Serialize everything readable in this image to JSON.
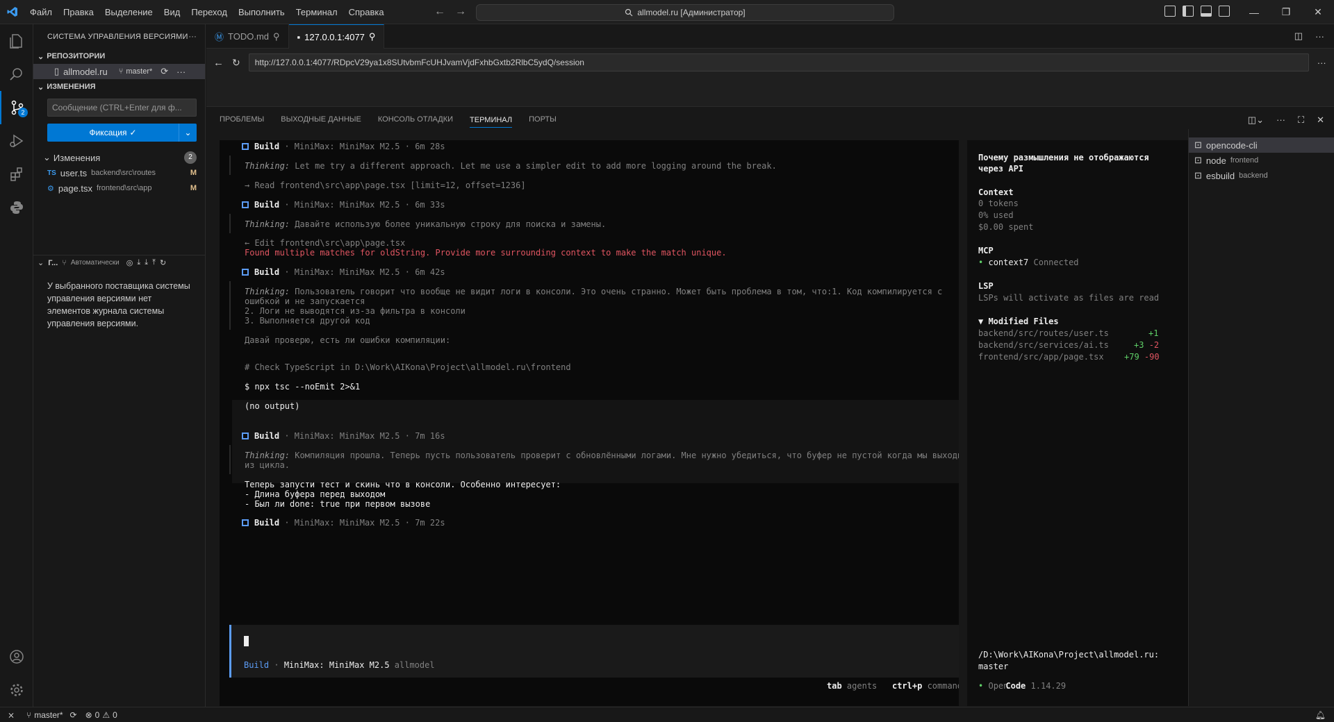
{
  "titlebar": {
    "menu": [
      "Файл",
      "Правка",
      "Выделение",
      "Вид",
      "Переход",
      "Выполнить",
      "Терминал",
      "Справка"
    ],
    "command_center": "allmodel.ru [Администратор]"
  },
  "sidebar": {
    "title": "СИСТЕМА УПРАВЛЕНИЯ ВЕРСИЯМИ",
    "repos_header": "РЕПОЗИТОРИИ",
    "repo_name": "allmodel.ru",
    "repo_branch": "master*",
    "changes_header": "ИЗМЕНЕНИЯ",
    "message_placeholder": "Сообщение (CTRL+Enter для ф...",
    "commit_label": "Фиксация",
    "changes_group": "Изменения",
    "changes_count": "2",
    "files": [
      {
        "icon": "TS",
        "name": "user.ts",
        "path": "backend\\src\\routes",
        "status": "M"
      },
      {
        "icon": "⚙",
        "name": "page.tsx",
        "path": "frontend\\src\\app",
        "status": "M"
      }
    ],
    "graph_title": "Г...",
    "graph_mode": "Автоматически",
    "graph_message": "У выбранного поставщика системы управления версиями нет элементов журнала системы управления версиями."
  },
  "tabs": [
    {
      "label": "TODO.md",
      "active": false
    },
    {
      "label": "127.0.0.1:4077",
      "active": true
    }
  ],
  "browser": {
    "url": "http://127.0.0.1:4077/RDpcV29ya1x8SUtvbmFcUHJvamVjdFxhbGxtb2RlbC5ydQ/session"
  },
  "panel": {
    "tabs": [
      "ПРОБЛЕМЫ",
      "ВЫХОДНЫЕ ДАННЫЕ",
      "КОНСОЛЬ ОТЛАДКИ",
      "ТЕРМИНАЛ",
      "ПОРТЫ"
    ],
    "active_tab": "ТЕРМИНАЛ"
  },
  "terminal": {
    "build1": {
      "label": "Build",
      "meta": "· MiniMax: MiniMax M2.5 · 6m 28s"
    },
    "thinking1_label": "Thinking:",
    "thinking1_text": "Let me try a different approach. Let me use a simpler edit to add more logging around the break.",
    "read_line": "→ Read frontend\\src\\app\\page.tsx [limit=12, offset=1236]",
    "build2": {
      "label": "Build",
      "meta": "· MiniMax: MiniMax M2.5 · 6m 33s"
    },
    "thinking2_label": "Thinking:",
    "thinking2_text": "Давайте использую более уникальную строку для поиска и замены.",
    "edit_line": "← Edit frontend\\src\\app\\page.tsx",
    "edit_error": "Found multiple matches for oldString. Provide more surrounding context to make the match unique.",
    "build3": {
      "label": "Build",
      "meta": "· MiniMax: MiniMax M2.5 · 6m 42s"
    },
    "thinking3_label": "Thinking:",
    "thinking3_line1": "Пользователь говорит что вообще не видит логи в консоли. Это очень странно. Может быть проблема в том, что:1. Код компилируется с",
    "thinking3_line2": "ошибкой и не запускается",
    "thinking3_line3": "2. Логи не выводятся из-за фильтра в консоли",
    "thinking3_line4": "3. Выполняется другой код",
    "check_text": "Давай проверю, есть ли ошибки компиляции:",
    "code_comment": "# Check TypeScript in D:\\Work\\AIKona\\Project\\allmodel.ru\\frontend",
    "code_cmd": "$ npx tsc --noEmit 2>&1",
    "code_output": "(no output)",
    "build4": {
      "label": "Build",
      "meta": "· MiniMax: MiniMax M2.5 · 7m 16s"
    },
    "thinking4_label": "Thinking:",
    "thinking4_line1": "Компиляция прошла. Теперь пусть пользователь проверит с обновлёнными логами. Мне нужно убедиться, что буфер не пустой когда мы выходим",
    "thinking4_line2": "из цикла.",
    "answer_line1": "Теперь запусти тест и скинь что в консоли. Особенно интересует:",
    "answer_line2": "- Длина буфера перед выходом",
    "answer_line3": "- Был ли done: true при первом вызове",
    "build5": {
      "label": "Build",
      "meta": "· MiniMax: MiniMax M2.5 · 7m 22s"
    },
    "prompt_agent": "Build",
    "prompt_model": "MiniMax: MiniMax M2.5",
    "prompt_project": "allmodel",
    "hint_tab_key": "tab",
    "hint_tab_label": "agents",
    "hint_cmd_key": "ctrl+p",
    "hint_cmd_label": "commands"
  },
  "info": {
    "title_line1": "Почему размышления не отображаются",
    "title_line2": "через API",
    "context_header": "Context",
    "tokens": "0 tokens",
    "used": "0% used",
    "spent": "$0.00 spent",
    "mcp_header": "MCP",
    "mcp_name": "context7",
    "mcp_status": "Connected",
    "lsp_header": "LSP",
    "lsp_text": "LSPs will activate as files are read",
    "modified_header": "▼ Modified Files",
    "modified": [
      {
        "path": "backend/src/routes/user.ts",
        "add": "+1",
        "del": ""
      },
      {
        "path": "backend/src/services/ai.ts",
        "add": "+3",
        "del": "-2"
      },
      {
        "path": "frontend/src/app/page.tsx",
        "add": "+79",
        "del": "-90"
      }
    ],
    "cwd_line1": "/D:\\Work\\AIKona\\Project\\allmodel.ru:",
    "cwd_line2": "master",
    "brand_a": "Open",
    "brand_b": "Code",
    "version": "1.14.29"
  },
  "terminal_list": [
    {
      "name": "opencode-cli",
      "sub": ""
    },
    {
      "name": "node",
      "sub": "frontend"
    },
    {
      "name": "esbuild",
      "sub": "backend"
    }
  ],
  "statusbar": {
    "branch": "master*",
    "errors": "0",
    "warnings": "0"
  },
  "colors": {
    "accent": "#0078d4",
    "error": "#e05561",
    "success": "#5fd068",
    "modified": "#e2c08d"
  }
}
